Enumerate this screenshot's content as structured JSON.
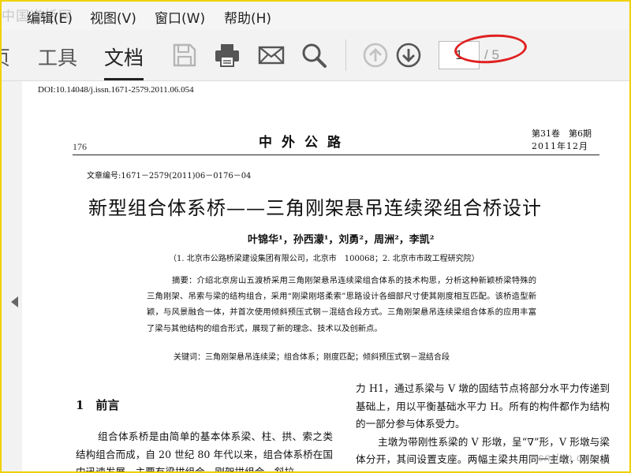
{
  "watermark_top": "中国道桥网",
  "watermark_bottom": "cnrlao.com",
  "menu": [
    {
      "label": "编辑(E)"
    },
    {
      "label": "视图(V)"
    },
    {
      "label": "窗口(W)"
    },
    {
      "label": "帮助(H)"
    }
  ],
  "toolbar": {
    "tabs": [
      {
        "label": "页"
      },
      {
        "label": "工具"
      },
      {
        "label": "文档"
      }
    ],
    "active_tab": "文档",
    "icons": [
      "save-icon",
      "print-icon",
      "mail-icon",
      "search-icon",
      "prev-page-icon",
      "next-page-icon"
    ],
    "page_current": "1",
    "page_total": "/ 5"
  },
  "document": {
    "doi": "DOI:10.14048/j.issn.1671-2579.2011.06.054",
    "page_number": "176",
    "journal": "中外公路",
    "volume": "第31卷　第6期",
    "date": "2011年12月",
    "article_no": "文章编号:1671－2579(2011)06－0176－04",
    "title": "新型组合体系桥——三角刚架悬吊连续梁组合桥设计",
    "authors": "叶锦华¹，孙西濛¹，刘勇²，周洲²，李凯²",
    "affiliation": "（1. 北京市公路桥梁建设集团有限公司，北京市　100068；2. 北京市市政工程研究院）",
    "abstract": "摘要：介绍北京房山五渡桥采用三角刚架悬吊连续梁组合体系的技术构思，分析这种新颖桥梁特殊的三角刚架、吊索与梁的结构组合，采用“刚梁刚塔柔索”思路设计各细部尺寸使其刚度相互匹配。该桥造型新颖，与风景融合一体，并首次使用倾斜预压式钢－混结合段方式。三角刚架悬吊连续梁组合体系的应用丰富了梁与其他结构的组合形式，展现了新的理念、技术以及创新点。",
    "keywords": "关键词：三角刚架悬吊连续梁；组合体系；刚度匹配；倾斜预压式钢－混结合段",
    "section_title": "1　前言",
    "col1_text": "组合体系桥是由简单的基本体系梁、柱、拱、索之类结构组合而成，自 20 世纪 80 年代以来，组合体系桥在国内迅速发展，主要有梁拱组合、刚架拱组合、斜拉",
    "col2_p1": "力 H1，通过系梁与 V 墩的固结节点将部分水平力传递到基础上，用以平衡基础水平力 H。所有的构件都作为结构的一部分参与体系受力。",
    "col2_p2": "主墩为带刚性系梁的 V 形墩，呈“∇”形，V 形墩与梁体分开，其间设置支座。两幅主梁共用同一主墩，刚架横与跨中侧主梁通过横座进行固定连接，刚架"
  }
}
